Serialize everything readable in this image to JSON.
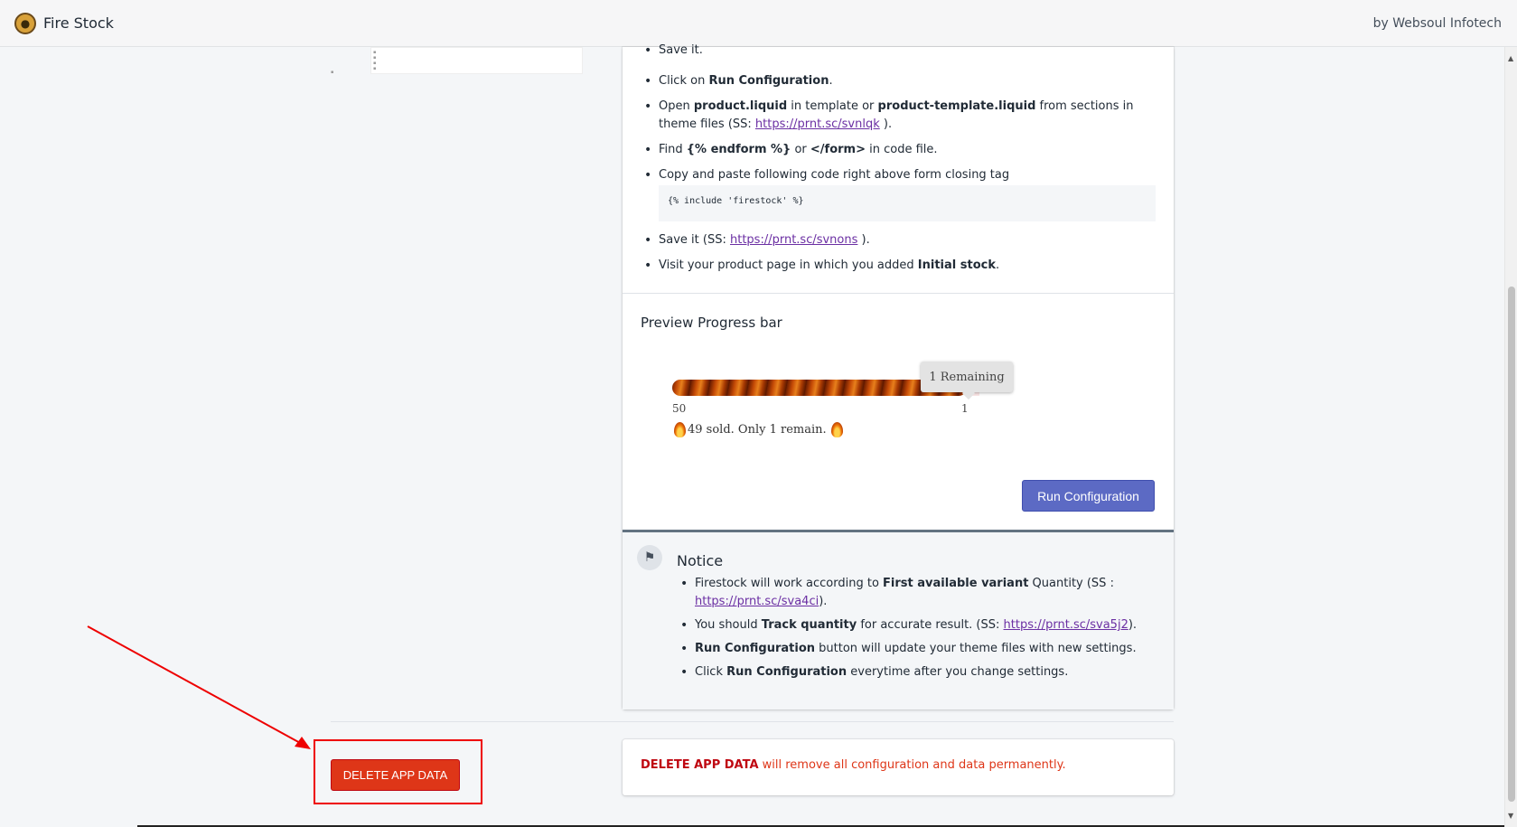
{
  "app": {
    "title": "Fire Stock",
    "vendor": "by Websoul Infotech"
  },
  "steps": {
    "s1": "Save it.",
    "s2_pre": "Click on ",
    "s2_b": "Run Configuration",
    "s2_post": ".",
    "s3_pre": "Open ",
    "s3_b1": "product.liquid",
    "s3_mid": " in template or ",
    "s3_b2": "product-template.liquid",
    "s3_mid2": " from sections in theme files (SS: ",
    "s3_link": "https://prnt.sc/svnlqk",
    "s3_post": " ).",
    "s4_pre": "Find ",
    "s4_b1": "{% endform %}",
    "s4_mid": " or ",
    "s4_b2": "</form>",
    "s4_post": " in code file.",
    "s5": "Copy and paste following code right above form closing tag",
    "code": "{% include 'firestock' %}",
    "s6_pre": "Save it (SS: ",
    "s6_link": "https://prnt.sc/svnons",
    "s6_post": " ).",
    "s7_pre": "Visit your product page in which you added ",
    "s7_b": "Initial stock",
    "s7_post": "."
  },
  "preview": {
    "title": "Preview Progress bar",
    "tooltip": "1 Remaining",
    "start_label": "50",
    "end_label": "1",
    "sold_text": "49 sold. Only 1 remain.",
    "progress_fraction": 0.98
  },
  "run_button": "Run Configuration",
  "notice": {
    "title": "Notice",
    "n1_pre": "Firestock will work according to ",
    "n1_b": "First available variant",
    "n1_mid": " Quantity (SS : ",
    "n1_link": "https://prnt.sc/sva4ci",
    "n1_post": ").",
    "n2_pre": "You should ",
    "n2_b": "Track quantity",
    "n2_mid": " for accurate result. (SS: ",
    "n2_link": "https://prnt.sc/sva5j2",
    "n2_post": ").",
    "n3_b": "Run Configuration",
    "n3_post": " button will update your theme files with new settings.",
    "n4_pre": "Click ",
    "n4_b": "Run Configuration",
    "n4_post": " everytime after you change settings."
  },
  "delete": {
    "button": "DELETE APP DATA",
    "msg_b": "DELETE APP DATA",
    "msg_post": " will remove all configuration and data permanently."
  },
  "colors": {
    "primary": "#5c6ac4",
    "danger": "#de3618",
    "annotation": "#ee0000"
  }
}
